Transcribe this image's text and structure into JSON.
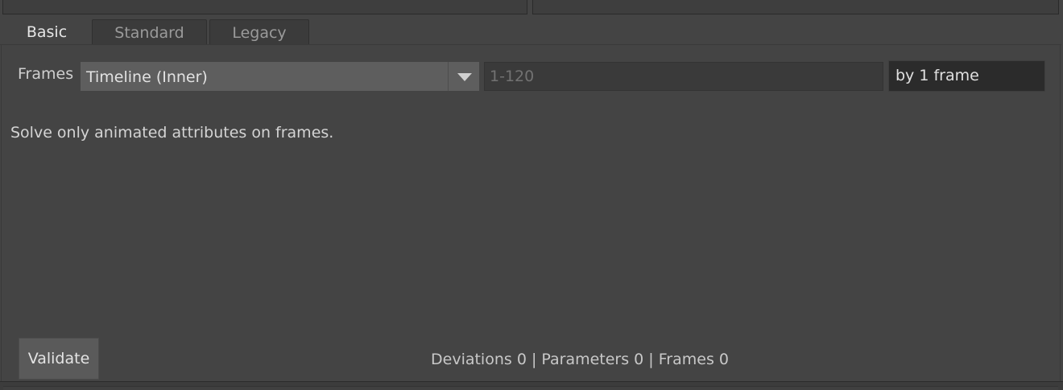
{
  "tabs": [
    {
      "label": "Basic",
      "active": true
    },
    {
      "label": "Standard",
      "active": false
    },
    {
      "label": "Legacy",
      "active": false
    }
  ],
  "frames": {
    "label": "Frames",
    "mode_selected": "Timeline (Inner)",
    "range_placeholder": "1-120",
    "step_value": "by 1 frame"
  },
  "description": "Solve only animated attributes on frames.",
  "footer": {
    "validate_label": "Validate",
    "status": "Deviations 0 | Parameters 0 | Frames 0"
  },
  "colors": {
    "background": "#444444",
    "select_bg": "#5e5e5e",
    "focus_accent": "#6a8da3"
  },
  "icons": {
    "dropdown": "chevron-down-icon"
  }
}
